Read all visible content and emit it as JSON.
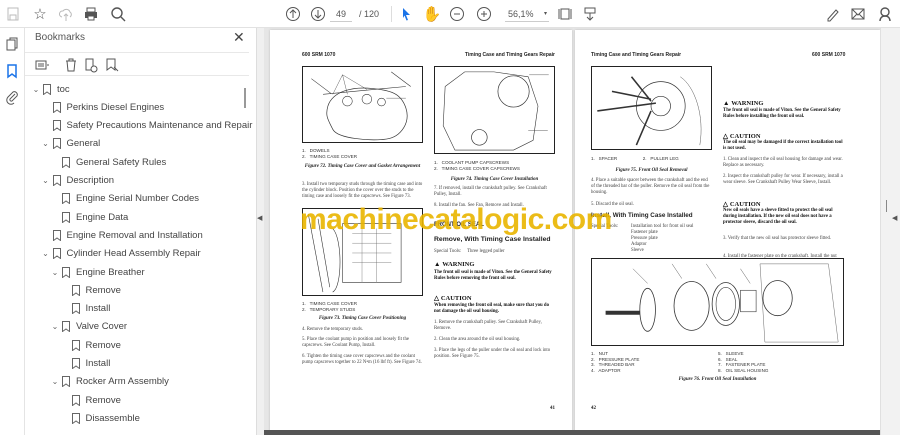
{
  "toolbar": {
    "current_page": "49",
    "total_pages": "/ 120",
    "zoom": "56,1%",
    "icons": [
      "save-icon",
      "bookmark-star-icon",
      "upload-icon",
      "print-icon",
      "search-icon",
      "page-up-icon",
      "page-down-icon",
      "select-cursor-icon",
      "hand-icon",
      "zoom-out-icon",
      "zoom-in-icon",
      "fit-page-icon",
      "scroll-mode-icon",
      "sign-icon",
      "mail-icon",
      "account-icon"
    ]
  },
  "bookmarks": {
    "title": "Bookmarks",
    "items": [
      {
        "label": "toc",
        "level": 0,
        "expandable": true
      },
      {
        "label": "Perkins Diesel Engines",
        "level": 1,
        "expandable": false
      },
      {
        "label": "Safety Precautions Maintenance and Repair",
        "level": 1,
        "expandable": false
      },
      {
        "label": "General",
        "level": 1,
        "expandable": true
      },
      {
        "label": "General Safety Rules",
        "level": 2,
        "expandable": false
      },
      {
        "label": "Description",
        "level": 1,
        "expandable": true
      },
      {
        "label": "Engine Serial Number Codes",
        "level": 2,
        "expandable": false
      },
      {
        "label": "Engine Data",
        "level": 2,
        "expandable": false
      },
      {
        "label": "Engine Removal and Installation",
        "level": 1,
        "expandable": false
      },
      {
        "label": "Cylinder Head Assembly Repair",
        "level": 1,
        "expandable": true
      },
      {
        "label": "Engine Breather",
        "level": 2,
        "expandable": true
      },
      {
        "label": "Remove",
        "level": 3,
        "expandable": false
      },
      {
        "label": "Install",
        "level": 3,
        "expandable": false
      },
      {
        "label": "Valve Cover",
        "level": 2,
        "expandable": true
      },
      {
        "label": "Remove",
        "level": 3,
        "expandable": false
      },
      {
        "label": "Install",
        "level": 3,
        "expandable": false
      },
      {
        "label": "Rocker Arm Assembly",
        "level": 2,
        "expandable": true
      },
      {
        "label": "Remove",
        "level": 3,
        "expandable": false
      },
      {
        "label": "Disassemble",
        "level": 3,
        "expandable": false
      }
    ]
  },
  "watermark": "machinecatalogic.com",
  "left_page": {
    "header_left": "600 SRM 1070",
    "header_right": "Timing Case and Timing Gears Repair",
    "fig72_legend": "1.   DOWELS\n2.   TIMING CASE COVER",
    "fig72_caption": "Figure 72. Timing Case Cover and Gasket Arrangement",
    "step3": "3.  Install two temporary studs through the timing case and into the cylinder block. Position the cover over the studs to the timing case and loosely fit the capscrews. See Figure 73.",
    "fig73_legend": "1.   TIMING CASE COVER\n2.   TEMPORARY STUDS",
    "fig73_caption": "Figure 73. Timing Case Cover Positioning",
    "step4": "4.  Remove the temporary studs.",
    "step5": "5.  Place the coolant pump in position and loosely fit the capscrews. See Coolant Pump, Install.",
    "step6": "6.  Tighten the timing case cover capscrews and the coolant pump capscrews together to 22 N•m (16 lbf ft). See Figure 74.",
    "fig74_legend": "1.   COOLANT PUMP CAPSCREWS\n2.   TIMING CASE COVER CAPSCREWS",
    "fig74_caption": "Figure 74. Timing Case Cover Installation",
    "step7": "7.  If removed, install the crankshaft pulley. See Crankshaft Pulley, Install.",
    "step8": "8.  Install the fan. See Fan, Remove and Install.",
    "section": "FRONT OIL SEAL",
    "subsection": "Remove, With Timing Case Installed",
    "special_tools": "Special Tools:     Three legged puller",
    "warning_label": "WARNING",
    "warning_text": "The front oil seal is made of Viton. See the General Safety Rules before removing the front oil seal.",
    "caution_label": "CAUTION",
    "caution_text": "When removing the front oil seal, make sure that you do not damage the oil seal housing.",
    "r_step1": "1.  Remove the crankshaft pulley. See Crankshaft Pulley, Remove.",
    "r_step2": "2.  Clean the area around the oil seal housing.",
    "r_step3": "3.  Place the legs of the puller under the oil seal and lock into position. See Figure 75.",
    "page_number": "41"
  },
  "right_page": {
    "header_left": "Timing Case and Timing Gears Repair",
    "header_right": "600 SRM 1070",
    "fig75_legend": "1.   SPACER                    2.   PULLER LEG",
    "fig75_caption": "Figure 75. Front Oil Seal Removal",
    "step4": "4.  Place a suitable spacer between the crankshaft and the end of the threaded bar of the puller. Remove the oil seal from the housing.",
    "step5": "5.  Discard the oil seal.",
    "subsection": "Install, With Timing Case Installed",
    "special_tools_label": "Special Tools:",
    "special_tools": "Installation tool for front oil seal\nFastener plate\nPressure plate\nAdaptor\nSleeve",
    "warning_label": "WARNING",
    "warning_text": "The front oil seal is made of Viton. See the General Safety Rules before installing the front oil seal.",
    "caution1_label": "CAUTION",
    "caution1_text": "The oil seal may be damaged if the correct installation tool is not used.",
    "i_step1": "1.  Clean and inspect the oil seal housing for damage and wear. Replace as necessary.",
    "i_step2": "2.  Inspect the crankshaft pulley for wear. If necessary, install a wear sleeve. See Crankshaft Pulley Wear Sleeve, Install.",
    "caution2_label": "CAUTION",
    "caution2_text": "New oil seals have a sleeve fitted to protect the oil seal during installation. If the new oil seal does not have a protector sleeve, discard the oil seal.",
    "i_step3": "3.  Verify that the new oil seal has protector sleeve fitted.",
    "i_step4": "4.  Install the fastener plate on the crankshaft. Install the nut and pressure plate onto the threaded bar. See Figure 76.",
    "fig76_legend_a": "1.   NUT\n2.   PRESSURE PLATE\n3.   THREADED BAR\n4.   ADAPTOR",
    "fig76_legend_b": "5.   SLEEVE\n6.   SEAL\n7.   FASTENER PLATE\n8.   OIL SEAL HOUSING",
    "fig76_caption": "Figure 76. Front Oil Seal Installation",
    "page_number": "42"
  }
}
